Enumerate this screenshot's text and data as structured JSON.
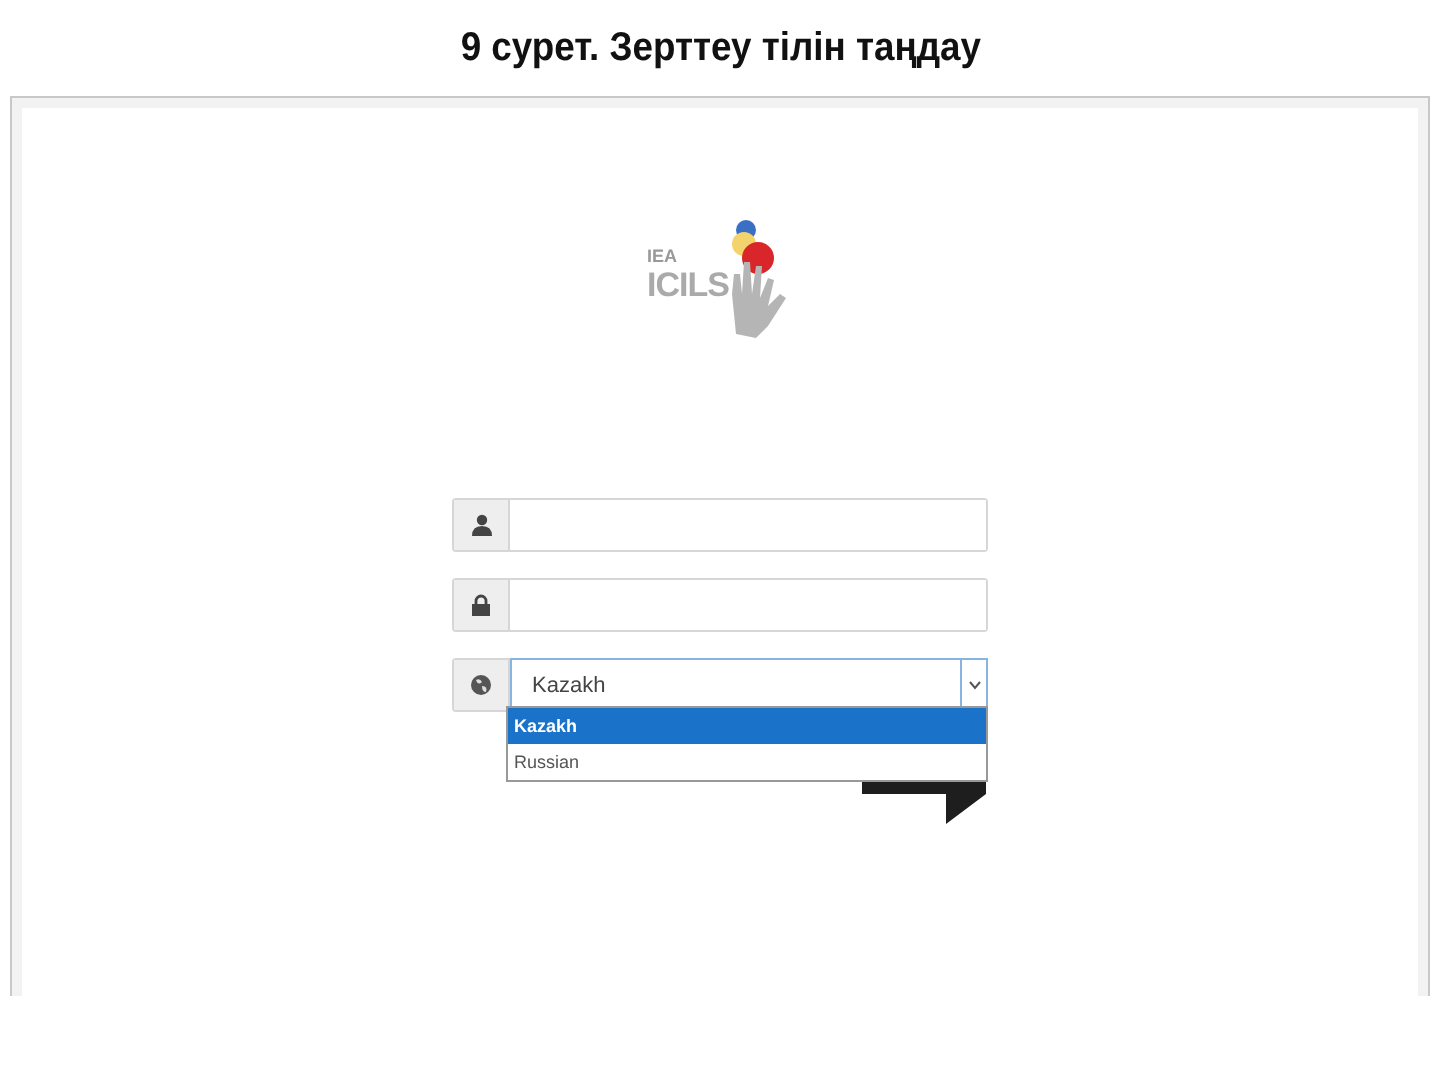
{
  "slide_title": "9 сурет. Зерттеу тілін таңдау",
  "logo": {
    "org": "IEA",
    "name": "ICILS"
  },
  "fields": [
    {
      "kind": "username"
    },
    {
      "kind": "password"
    }
  ],
  "language_select": {
    "value": "Kazakh",
    "expanded": true,
    "options": [
      {
        "label": "Kazakh",
        "selected": true
      },
      {
        "label": "Russian",
        "selected": false
      }
    ]
  }
}
